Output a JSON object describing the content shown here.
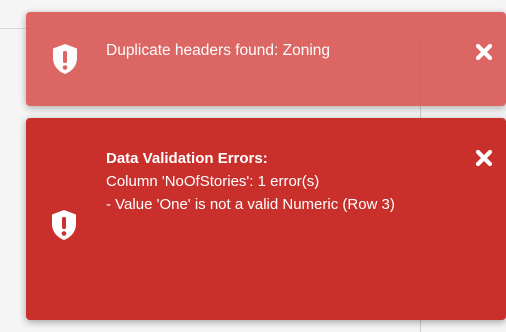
{
  "toasts": {
    "warning": {
      "message": "Duplicate headers found: Zoning",
      "icon": "shield-exclamation-icon",
      "close_icon": "close-icon",
      "color": "#d9534f"
    },
    "error": {
      "title": "Data Validation Errors:",
      "lines": [
        "Column 'NoOfStories': 1 error(s)",
        "- Value 'One' is not a valid Numeric (Row 3)"
      ],
      "icon": "shield-exclamation-icon",
      "close_icon": "close-icon",
      "color": "#c9302c"
    }
  }
}
